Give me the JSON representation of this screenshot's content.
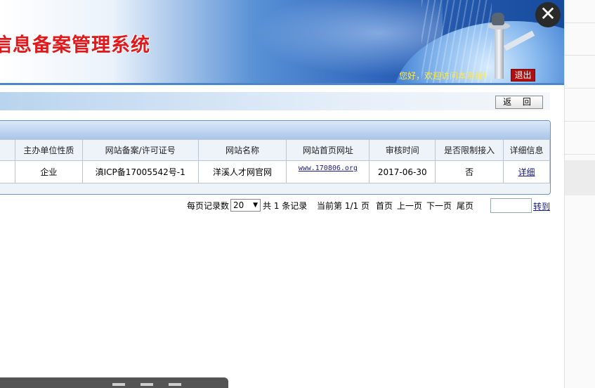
{
  "header": {
    "title": "信息备案管理系统",
    "welcome": "您好，欢迎访问本系统!",
    "logout_label": "退出"
  },
  "toolbar": {
    "back_label": "返 回"
  },
  "table": {
    "columns": [
      "主办单位性质",
      "网站备案/许可证号",
      "网站名称",
      "网站首页网址",
      "审核时间",
      "是否限制接入",
      "详细信息"
    ],
    "rows": [
      {
        "org_type": "企业",
        "license": "滇ICP备17005542号-1",
        "site_name": "洋溪人才网官网",
        "url": "www.170806.org",
        "review_time": "2017-06-30",
        "restricted": "否",
        "detail": "详细"
      }
    ]
  },
  "pager": {
    "per_page_label": "每页记录数",
    "per_page_value": "20",
    "total_text": "共 1 条记录",
    "current_text": "当前第 1/1 页",
    "first": "首页",
    "prev": "上一页",
    "next": "下一页",
    "last": "尾页",
    "goto": "转到"
  },
  "overlay": {
    "close_symbol": "✕"
  },
  "colors": {
    "header_title": "#e0191c",
    "accent_blue": "#2a61b8",
    "logout_bg": "#b01010",
    "welcome_text": "#ffe94a"
  }
}
